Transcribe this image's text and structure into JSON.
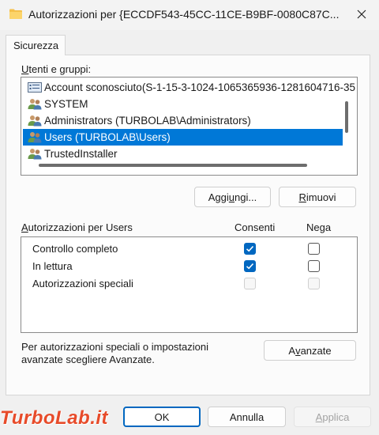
{
  "window": {
    "title": "Autorizzazioni per {ECCDF543-45CC-11CE-B9BF-0080C87C...",
    "close_icon": "close-icon",
    "title_icon": "folder-icon"
  },
  "tab": {
    "label": "Sicurezza"
  },
  "users": {
    "group_label_mnemonic": "U",
    "group_label_rest": "tenti e gruppi:",
    "items": [
      {
        "label": "Account sconosciuto(S-1-15-3-1024-1065365936-1281604716-35",
        "icon": "unknown-account-icon",
        "selected": false
      },
      {
        "label": "SYSTEM",
        "icon": "users-group-icon",
        "selected": false
      },
      {
        "label": "Administrators (TURBOLAB\\Administrators)",
        "icon": "users-group-icon",
        "selected": false
      },
      {
        "label": "Users (TURBOLAB\\Users)",
        "icon": "users-group-icon",
        "selected": true
      },
      {
        "label": "TrustedInstaller",
        "icon": "users-group-icon",
        "selected": false
      }
    ],
    "add_pre": "Aggi",
    "add_mnemonic": "u",
    "add_post": "ngi...",
    "remove_mnemonic": "R",
    "remove_post": "imuovi"
  },
  "permissions": {
    "header_mnemonic": "A",
    "header_rest": "utorizzazioni per Users",
    "allow_label": "Consenti",
    "deny_label": "Nega",
    "rows": [
      {
        "name": "Controllo completo",
        "allow": "checked",
        "deny": "unchecked"
      },
      {
        "name": "In lettura",
        "allow": "checked",
        "deny": "unchecked"
      },
      {
        "name": "Autorizzazioni speciali",
        "allow": "disabled",
        "deny": "disabled"
      }
    ]
  },
  "advanced": {
    "note_line1": "Per autorizzazioni speciali o impostazioni",
    "note_line2": "avanzate scegliere Avanzate.",
    "button_pre": "A",
    "button_mnemonic": "v",
    "button_post": "anzate"
  },
  "footer": {
    "ok_label": "OK",
    "cancel_label": "Annulla",
    "apply_mnemonic": "A",
    "apply_post": "pplica"
  },
  "watermark": {
    "text": "TurboLab.it"
  },
  "colors": {
    "accent": "#0067c0",
    "selection": "#0078d7",
    "watermark": "#e74b2a"
  }
}
